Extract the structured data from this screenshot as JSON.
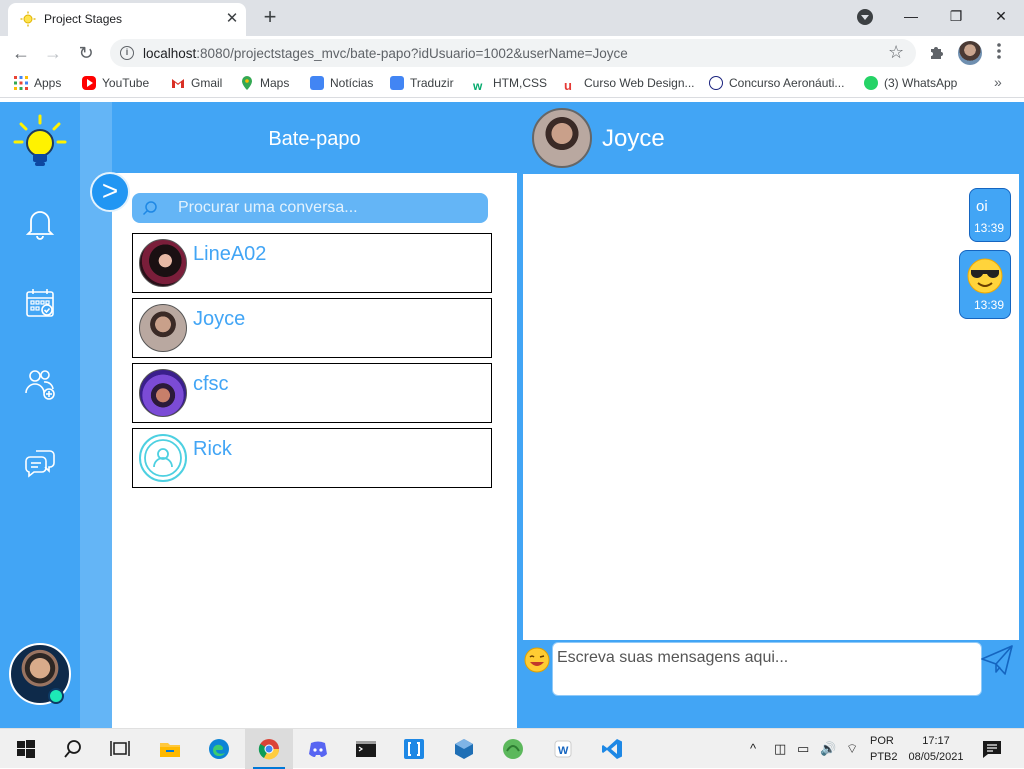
{
  "browser": {
    "tab_title": "Project Stages",
    "tab_close": "✕",
    "new_tab": "+",
    "window_controls": {
      "minimize": "—",
      "maximize": "❐",
      "close": "✕"
    },
    "nav": {
      "back": "←",
      "forward": "→",
      "reload": "↻"
    },
    "url_host": "localhost",
    "url_rest": ":8080/projectstages_mvc/bate-papo?idUsuario=1002&userName=Joyce",
    "bookmarks": [
      {
        "label": "Apps",
        "icon": "apps-grid-icon",
        "color": "#ea4335"
      },
      {
        "label": "YouTube",
        "icon": "youtube-icon",
        "color": "#ff0000"
      },
      {
        "label": "Gmail",
        "icon": "gmail-icon",
        "color": "#d93025"
      },
      {
        "label": "Maps",
        "icon": "maps-icon",
        "color": "#34a853"
      },
      {
        "label": "Notícias",
        "icon": "news-icon",
        "color": "#4285f4"
      },
      {
        "label": "Traduzir",
        "icon": "translate-icon",
        "color": "#4285f4"
      },
      {
        "label": "HTM,CSS",
        "icon": "w3-icon",
        "color": "#04aa6d"
      },
      {
        "label": "Curso Web Design...",
        "icon": "course-icon",
        "color": "#e53935"
      },
      {
        "label": "Concurso Aeronáuti...",
        "icon": "contest-icon",
        "color": "#1a237e"
      },
      {
        "label": "(3) WhatsApp",
        "icon": "whatsapp-icon",
        "color": "#25d366"
      }
    ],
    "bookmarks_more": "»"
  },
  "app": {
    "colors": {
      "primary": "#42a5f5",
      "dark": "#1565c0",
      "online": "#1de9b6"
    },
    "nav_icons": [
      "lightbulb-logo-icon",
      "bell-icon",
      "calendar-icon",
      "add-user-icon",
      "chat-icon"
    ],
    "chat_list": {
      "title": "Bate-papo",
      "collapse": ">",
      "search_placeholder": "Procurar uma conversa...",
      "contacts": [
        {
          "name": "LineA02",
          "avatar": "photo"
        },
        {
          "name": "Joyce",
          "avatar": "photo"
        },
        {
          "name": "cfsc",
          "avatar": "photo"
        },
        {
          "name": "Rick",
          "avatar": "default-user-icon"
        }
      ]
    },
    "chat": {
      "contact_name": "Joyce",
      "messages": [
        {
          "text": "oi",
          "time": "13:39",
          "type": "text"
        },
        {
          "text": "😎",
          "time": "13:39",
          "type": "emoji"
        }
      ],
      "input_placeholder": "Escreva suas mensagens aqui..."
    }
  },
  "taskbar": {
    "lang_1": "POR",
    "lang_2": "PTB2",
    "time": "17:17",
    "date": "08/05/2021"
  }
}
